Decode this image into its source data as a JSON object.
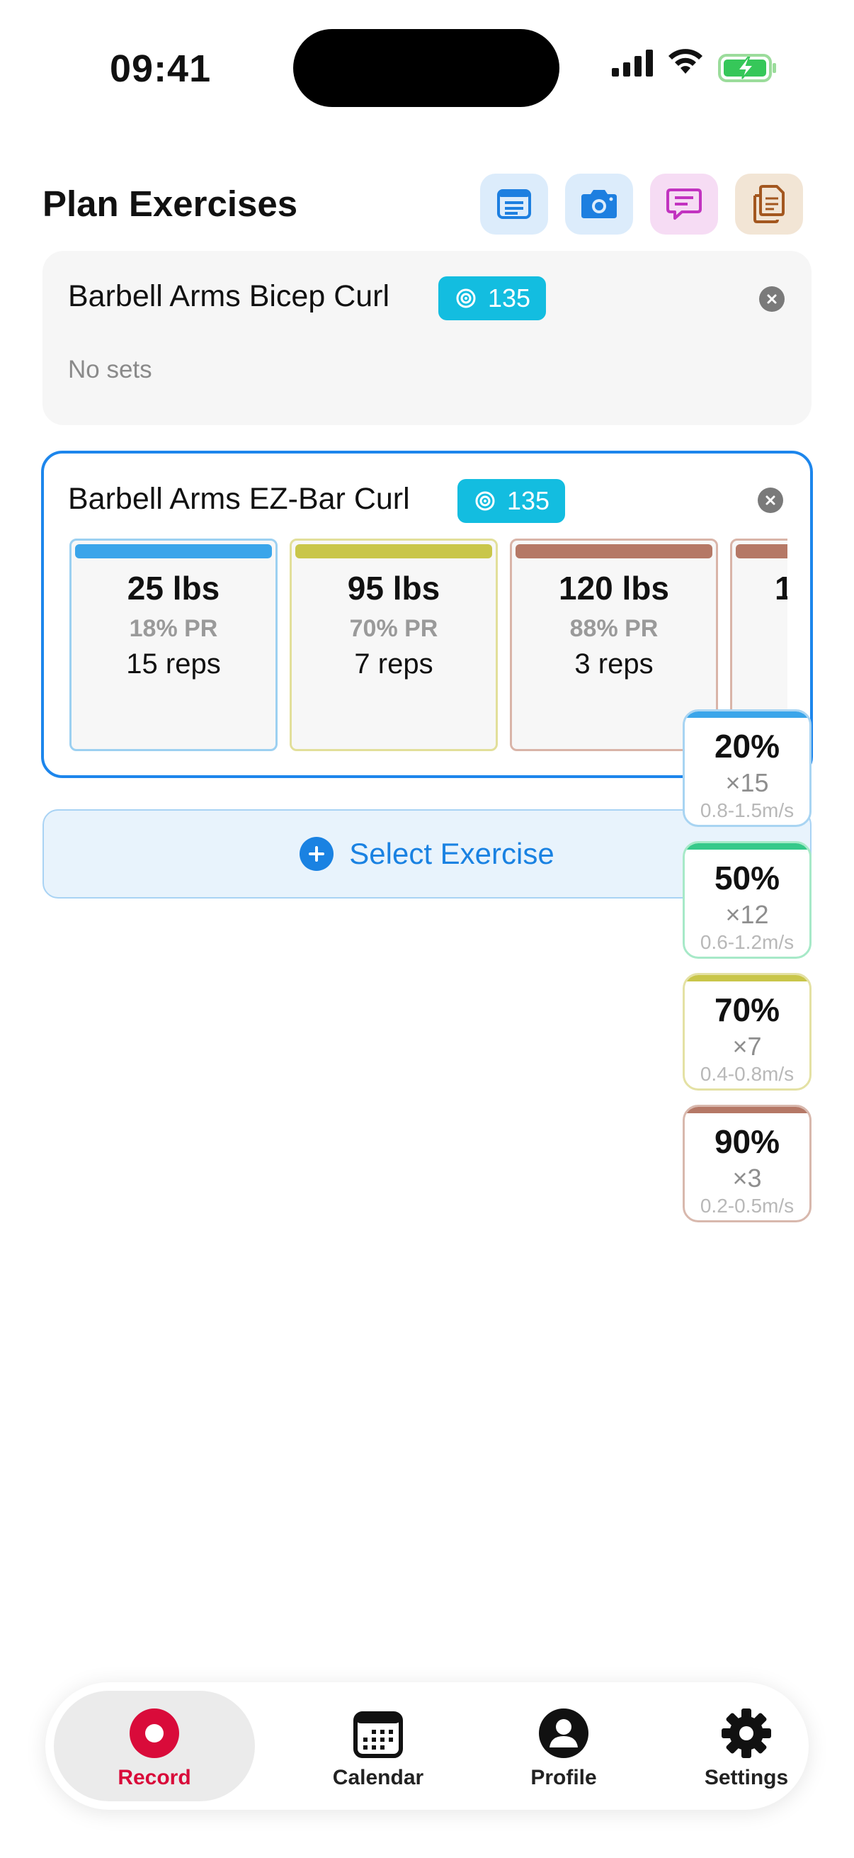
{
  "status_bar": {
    "time": "09:41"
  },
  "header": {
    "title": "Plan Exercises",
    "buttons": [
      {
        "name": "notes",
        "icon": "document-lines-icon",
        "bg": "#dcecfb",
        "color": "#1d7fe0"
      },
      {
        "name": "camera",
        "icon": "camera-icon",
        "bg": "#dcecfb",
        "color": "#1d7fe0"
      },
      {
        "name": "chat",
        "icon": "chat-bubble-icon",
        "bg": "#f6dcf4",
        "color": "#c233c0"
      },
      {
        "name": "copy",
        "icon": "copy-documents-icon",
        "bg": "#f2e5d5",
        "color": "#a3571f"
      }
    ]
  },
  "exercises": [
    {
      "name": "Barbell Arms Bicep Curl",
      "target": "135",
      "empty_text": "No sets"
    },
    {
      "name": "Barbell Arms EZ-Bar Curl",
      "target": "135",
      "sets": [
        {
          "weight": "25 lbs",
          "pr": "18% PR",
          "reps": "15 reps",
          "color": "#3aa5ea",
          "border": "#9cd0f1"
        },
        {
          "weight": "95 lbs",
          "pr": "70% PR",
          "reps": "7 reps",
          "color": "#c9c64a",
          "border": "#e2df9a"
        },
        {
          "weight": "120 lbs",
          "pr": "88% PR",
          "reps": "3 reps",
          "color": "#b57866",
          "border": "#d9b4a8"
        },
        {
          "weight": "1",
          "pr": "",
          "reps": "",
          "color": "#b57866",
          "border": "#d9b4a8"
        }
      ]
    }
  ],
  "select_exercise": {
    "label": "Select Exercise"
  },
  "intensity_chips": [
    {
      "pct": "20%",
      "mult": "×15",
      "velocity": "0.8-1.5m/s",
      "color": "#3aa5ea",
      "border": "#a8d4f2"
    },
    {
      "pct": "50%",
      "mult": "×12",
      "velocity": "0.6-1.2m/s",
      "color": "#36c98a",
      "border": "#a7e9c8"
    },
    {
      "pct": "70%",
      "mult": "×7",
      "velocity": "0.4-0.8m/s",
      "color": "#c9c64a",
      "border": "#e4e1a4"
    },
    {
      "pct": "90%",
      "mult": "×3",
      "velocity": "0.2-0.5m/s",
      "color": "#b57866",
      "border": "#d8b8ad"
    }
  ],
  "tabs": [
    {
      "label": "Record",
      "icon": "record-icon",
      "selected": true
    },
    {
      "label": "Calendar",
      "icon": "calendar-icon",
      "selected": false
    },
    {
      "label": "Profile",
      "icon": "person-icon",
      "selected": false
    },
    {
      "label": "Settings",
      "icon": "gear-icon",
      "selected": false
    }
  ]
}
